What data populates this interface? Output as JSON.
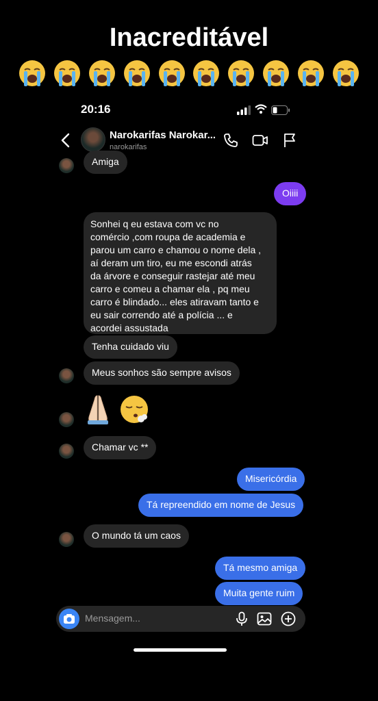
{
  "caption": "Inacreditável",
  "emoji_row": {
    "icon": "loudly-crying-face-icon",
    "count": 10
  },
  "status_bar": {
    "time": "20:16"
  },
  "header": {
    "name": "Narokarifas Narokar...",
    "username": "narokarifas"
  },
  "messages": [
    {
      "from": "them",
      "text": "Amiga"
    },
    {
      "from": "me",
      "text": "Oiiii"
    },
    {
      "from": "them",
      "text": "Sonhei q eu estava  com vc no\ncomércio ,com roupa de academia e\nparou um carro e chamou o nome dela ,\naí deram um tiro, eu me escondi atrás\nda árvore e conseguir rastejar até meu\ncarro e comeu a chamar ela , pq meu\ncarro é blindado... eles atiravam tanto e\neu sair correndo até a polícia ... e\nacordei assustada"
    },
    {
      "from": "them",
      "text": "Tenha cuidado viu"
    },
    {
      "from": "them",
      "text": "Meus sonhos são sempre avisos"
    },
    {
      "from": "them",
      "emoji": [
        "folded-hands-icon",
        "face-exhaling-icon"
      ]
    },
    {
      "from": "them",
      "text": "Chamar vc **"
    },
    {
      "from": "me",
      "text": "Misericórdia"
    },
    {
      "from": "me",
      "text": "Tá repreendido em nome de Jesus"
    },
    {
      "from": "them",
      "text": "O mundo tá um caos"
    },
    {
      "from": "me",
      "text": "Tá mesmo amiga"
    },
    {
      "from": "me",
      "text": "Muita gente ruim"
    }
  ],
  "composer": {
    "placeholder": "Mensagem..."
  },
  "colors": {
    "outgoing": "#3a6fe8",
    "incoming": "#262626",
    "first_outgoing": "#7c3cf0",
    "camera": "#3a85f5"
  }
}
